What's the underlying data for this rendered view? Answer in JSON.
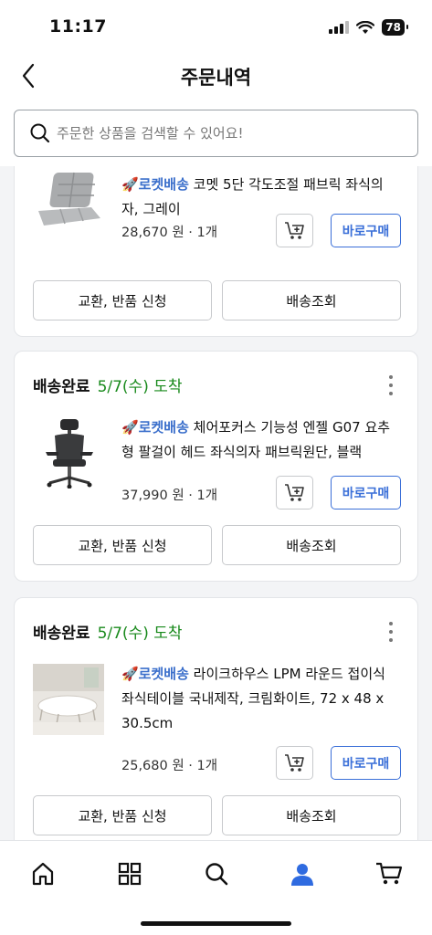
{
  "status_bar": {
    "time": "11:17",
    "battery": "78"
  },
  "header": {
    "title": "주문내역"
  },
  "search": {
    "placeholder": "주문한 상품을 검색할 수 있어요!"
  },
  "orders": [
    {
      "status": "",
      "arrival": "",
      "badge": "🚀로켓배송",
      "name": "코멧 5단 각도조절 패브릭 좌식의자, 그레이",
      "price": "28,670 원 · 1개",
      "buy_label": "바로구매",
      "exchange_label": "교환, 반품 신청",
      "tracking_label": "배송조회"
    },
    {
      "status": "배송완료",
      "arrival": "5/7(수) 도착",
      "badge": "🚀로켓배송",
      "name": "체어포커스 기능성 엔젤 G07 요추형 팔걸이 헤드 좌식의자 패브릭원단, 블랙",
      "price": "37,990 원 · 1개",
      "buy_label": "바로구매",
      "exchange_label": "교환, 반품 신청",
      "tracking_label": "배송조회"
    },
    {
      "status": "배송완료",
      "arrival": "5/7(수) 도착",
      "badge": "🚀로켓배송",
      "name": "라이크하우스 LPM 라운드 접이식 좌식테이블 국내제작, 크림화이트, 72 x 48 x 30.5cm",
      "price": "25,680 원 · 1개",
      "buy_label": "바로구매",
      "exchange_label": "교환, 반품 신청",
      "tracking_label": "배송조회"
    }
  ],
  "bottom_nav": [
    "home-icon",
    "category-grid-icon",
    "search-icon",
    "my-account-icon",
    "cart-icon"
  ],
  "colors": {
    "accent": "#3a6fd8",
    "arrival": "#198a1c",
    "active_tab": "#2f6be0"
  }
}
